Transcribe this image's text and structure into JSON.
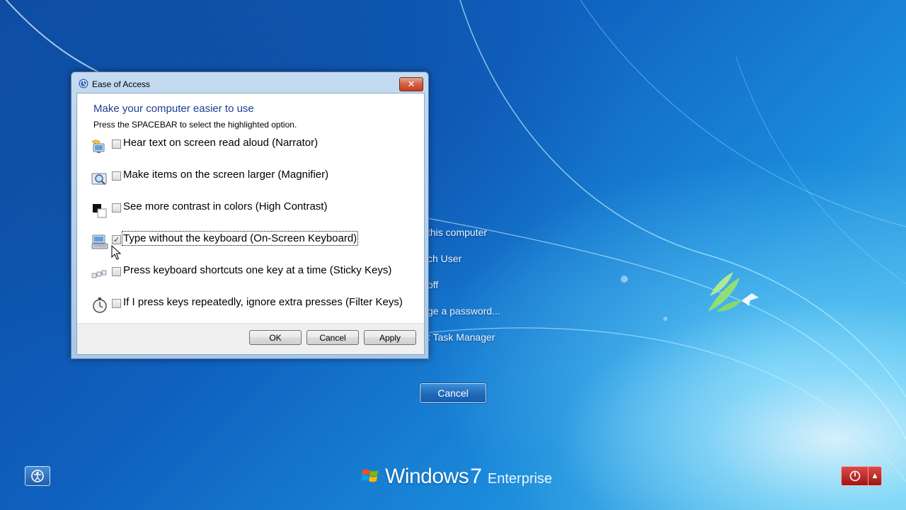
{
  "background": {
    "security_options": [
      "this computer",
      "ch User",
      "off",
      "ge a password...",
      "t Task Manager"
    ],
    "cancel_label": "Cancel"
  },
  "branding": {
    "windows_word": "Windows",
    "version": "7",
    "edition": "Enterprise"
  },
  "dialog": {
    "title": "Ease of Access",
    "close_glyph": "✕",
    "heading": "Make your computer easier to use",
    "instruction": "Press the SPACEBAR to select the highlighted option.",
    "options": [
      {
        "label": "Hear text on screen read aloud (Narrator)",
        "checked": false,
        "icon": "narrator-icon"
      },
      {
        "label": "Make items on the screen larger (Magnifier)",
        "checked": false,
        "icon": "magnifier-icon"
      },
      {
        "label": "See more contrast in colors (High Contrast)",
        "checked": false,
        "icon": "high-contrast-icon"
      },
      {
        "label": "Type without the keyboard (On-Screen Keyboard)",
        "checked": true,
        "icon": "keyboard-icon"
      },
      {
        "label": "Press keyboard shortcuts one key at a time (Sticky Keys)",
        "checked": false,
        "icon": "sticky-keys-icon"
      },
      {
        "label": "If I press keys repeatedly, ignore extra presses (Filter Keys)",
        "checked": false,
        "icon": "filter-keys-icon"
      }
    ],
    "buttons": {
      "ok": "OK",
      "cancel": "Cancel",
      "apply": "Apply"
    }
  },
  "colors": {
    "heading": "#1e3c93",
    "power_button": "#c62424",
    "background_blue": "#0f61bf"
  }
}
